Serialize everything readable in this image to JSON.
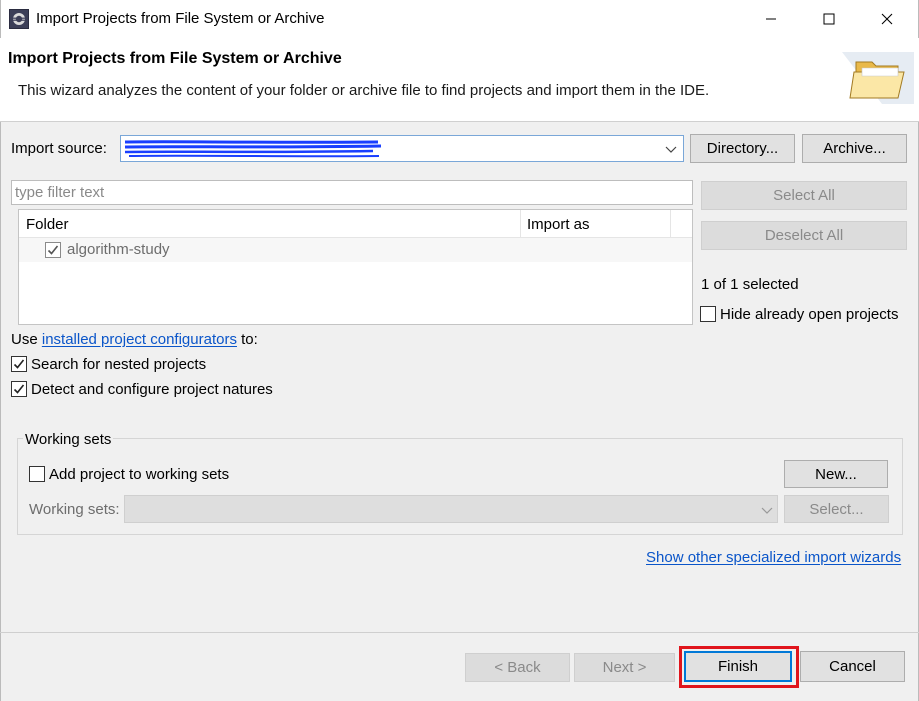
{
  "window": {
    "title": "Import Projects from File System or Archive",
    "controls": [
      "minimize",
      "maximize",
      "close"
    ]
  },
  "header": {
    "title": "Import Projects from File System or Archive",
    "description": "This wizard analyzes the content of your folder or archive file to find projects and import them in the IDE.",
    "icon": "folder-icon"
  },
  "source": {
    "label": "Import source:",
    "value": "",
    "directory_button": "Directory...",
    "archive_button": "Archive..."
  },
  "filter": {
    "placeholder": "type filter text"
  },
  "table": {
    "columns": [
      "Folder",
      "Import as"
    ],
    "rows": [
      {
        "folder": "algorithm-study",
        "import_as": "",
        "checked": true
      }
    ]
  },
  "side": {
    "select_all": "Select All",
    "deselect_all": "Deselect All",
    "selection_count": "1 of 1 selected",
    "hide_open_label": "Hide already open projects",
    "hide_open_checked": false
  },
  "configurators": {
    "prefix": "Use",
    "link": "installed project configurators",
    "suffix": "to:",
    "options": [
      {
        "label": "Search for nested projects",
        "checked": true
      },
      {
        "label": "Detect and configure project natures",
        "checked": true
      }
    ]
  },
  "working_sets": {
    "group_title": "Working sets",
    "add_label": "Add project to working sets",
    "add_checked": false,
    "new_button": "New...",
    "sets_label": "Working sets:",
    "select_button": "Select..."
  },
  "other_wizards_link": "Show other specialized import wizards",
  "footer": {
    "back": "< Back",
    "next": "Next >",
    "finish": "Finish",
    "cancel": "Cancel"
  },
  "colors": {
    "highlight": "#e0151c",
    "link": "#0a55c9",
    "redaction": "#1a3fff"
  }
}
